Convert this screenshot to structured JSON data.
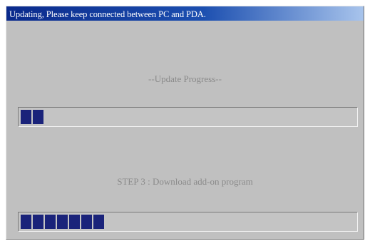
{
  "window": {
    "title": "Updating, Please keep connected between PC and PDA."
  },
  "overall": {
    "label": "--Update Progress--",
    "progress_blocks": 2
  },
  "step": {
    "label": "STEP 3 : Download add-on program",
    "progress_blocks": 7
  },
  "colors": {
    "progress_fill": "#1a237a",
    "title_bar": "#0a2a8c",
    "window_background": "#c0c0c0"
  }
}
